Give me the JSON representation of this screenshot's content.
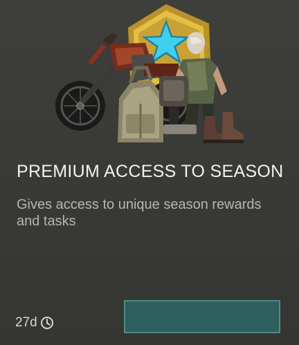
{
  "card": {
    "title": "PREMIUM ACCESS TO SEASON",
    "description": "Gives access to unique season rewards and tasks"
  },
  "timer": {
    "remaining": "27d",
    "icon": "clock-icon"
  },
  "buy_button": {
    "label": ""
  },
  "art": {
    "items": [
      "star-badge",
      "motorcycle",
      "backpack",
      "survivor-figure",
      "boots",
      "chest-armor"
    ]
  },
  "colors": {
    "background": "#3a3a37",
    "button_fill": "#2e5e5d",
    "button_border": "#4d8c88",
    "badge_gold": "#d8b43a",
    "star_cyan": "#35c9e6"
  }
}
